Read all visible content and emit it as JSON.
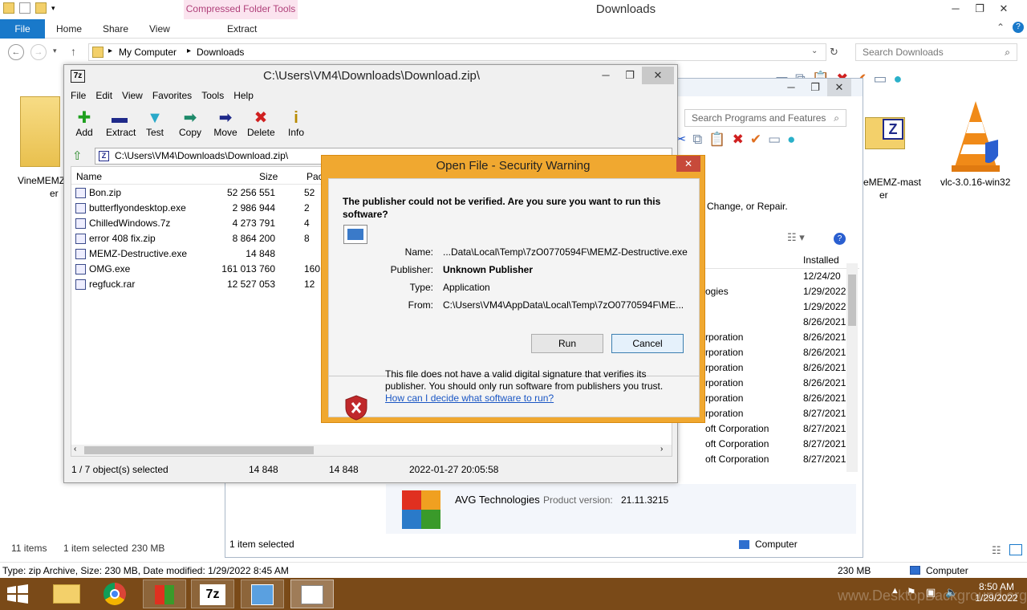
{
  "explorer": {
    "title": "Downloads",
    "context_tab": "Compressed Folder Tools",
    "ribbon_tabs": [
      "File",
      "Home",
      "Share",
      "View"
    ],
    "extract_tab": "Extract",
    "breadcrumb": [
      "My Computer",
      "Downloads"
    ],
    "search_placeholder": "Search Downloads",
    "files": [
      {
        "name": "VineMEMZer",
        "label1": "VineMEMZ",
        "label2": "er"
      },
      {
        "name": "VineMEMZ-master",
        "label1": "eMEMZ-mast",
        "label2": "er"
      },
      {
        "name": "vlc-3.0.16-win32",
        "label1": "vlc-3.0.16-win32",
        "label2": ""
      }
    ],
    "status": {
      "item_count": "11 items",
      "selected": "1 item selected",
      "size": "230 MB"
    },
    "details": {
      "info": "Type: zip Archive, Size: 230 MB, Date modified: 1/29/2022 8:45 AM",
      "size": "230 MB",
      "location": "Computer"
    }
  },
  "programs": {
    "search_placeholder": "Search Programs and Features",
    "subtitle": "Change, or Repair.",
    "column_installed": "Installed",
    "rows": [
      {
        "publisher": "",
        "installed": "12/24/20"
      },
      {
        "publisher": "ogies",
        "installed": "1/29/2022"
      },
      {
        "publisher": "",
        "installed": "1/29/2022"
      },
      {
        "publisher": "",
        "installed": "8/26/2021"
      },
      {
        "publisher": "rporation",
        "installed": "8/26/2021"
      },
      {
        "publisher": "rporation",
        "installed": "8/26/2021"
      },
      {
        "publisher": "rporation",
        "installed": "8/26/2021"
      },
      {
        "publisher": "rporation",
        "installed": "8/26/2021"
      },
      {
        "publisher": "rporation",
        "installed": "8/26/2021"
      },
      {
        "publisher": "rporation",
        "installed": "8/27/2021"
      },
      {
        "publisher": "oft Corporation",
        "installed": "8/27/2021"
      },
      {
        "publisher": "oft Corporation",
        "installed": "8/27/2021"
      },
      {
        "publisher": "oft Corporation",
        "installed": "8/27/2021"
      }
    ],
    "selected_product": {
      "publisher": "AVG Technologies",
      "version_label": "Product version:",
      "version": "21.11.3215"
    },
    "status": {
      "selected": "1 item selected",
      "location": "Computer"
    }
  },
  "sevenzip": {
    "title": "C:\\Users\\VM4\\Downloads\\Download.zip\\",
    "menu": [
      "File",
      "Edit",
      "View",
      "Favorites",
      "Tools",
      "Help"
    ],
    "toolbar": [
      {
        "label": "Add",
        "icon": "plus-icon",
        "glyph": "✚",
        "color": "#1ea01e"
      },
      {
        "label": "Extract",
        "icon": "minus-icon",
        "glyph": "▬",
        "color": "#1f2a8a"
      },
      {
        "label": "Test",
        "icon": "check-arrow-icon",
        "glyph": "▼",
        "color": "#29a9c9"
      },
      {
        "label": "Copy",
        "icon": "copy-arrow-icon",
        "glyph": "➡",
        "color": "#1e8a6a"
      },
      {
        "label": "Move",
        "icon": "move-arrow-icon",
        "glyph": "➡",
        "color": "#1f2a8a"
      },
      {
        "label": "Delete",
        "icon": "delete-x-icon",
        "glyph": "✖",
        "color": "#d02020"
      },
      {
        "label": "Info",
        "icon": "info-icon",
        "glyph": "i",
        "color": "#b88a00"
      }
    ],
    "path": "C:\\Users\\VM4\\Downloads\\Download.zip\\",
    "columns": {
      "name": "Name",
      "size": "Size",
      "packed": "Pac"
    },
    "rows": [
      {
        "name": "Bon.zip",
        "size": "52 256 551",
        "packed": "52"
      },
      {
        "name": "butterflyondesktop.exe",
        "size": "2 986 944",
        "packed": "2"
      },
      {
        "name": "ChilledWindows.7z",
        "size": "4 273 791",
        "packed": "4"
      },
      {
        "name": "error 408 fix.zip",
        "size": "8 864 200",
        "packed": "8"
      },
      {
        "name": "MEMZ-Destructive.exe",
        "size": "14 848",
        "packed": ""
      },
      {
        "name": "OMG.exe",
        "size": "161 013 760",
        "packed": "160"
      },
      {
        "name": "regfuck.rar",
        "size": "12 527 053",
        "packed": "12"
      }
    ],
    "status": {
      "selected": "1 / 7 object(s) selected",
      "size": "14 848",
      "packed": "14 848",
      "modified": "2022-01-27 20:05:58"
    }
  },
  "dialog": {
    "title": "Open File - Security Warning",
    "question": "The publisher could not be verified.  Are you sure you want to run this software?",
    "fields": [
      {
        "label": "Name:",
        "value": "...Data\\Local\\Temp\\7zO0770594F\\MEMZ-Destructive.exe",
        "bold": false
      },
      {
        "label": "Publisher:",
        "value": "Unknown Publisher",
        "bold": true
      },
      {
        "label": "Type:",
        "value": "Application",
        "bold": false
      },
      {
        "label": "From:",
        "value": "C:\\Users\\VM4\\AppData\\Local\\Temp\\7zO0770594F\\ME...",
        "bold": false
      }
    ],
    "run_label": "Run",
    "cancel_label": "Cancel",
    "footer_text": "This file does not have a valid digital signature that verifies its publisher.  You should only run software from publishers you trust.",
    "footer_link": "How can I decide what software to run?"
  },
  "taskbar": {
    "time": "8:50 AM",
    "date": "1/29/2022",
    "watermark": "www.DesktopBackground.org"
  },
  "colors": {
    "accent": "#1979ca",
    "dialog_frame": "#f0a830",
    "taskbar": "#7a4a18",
    "close_red": "#c74a3a"
  }
}
